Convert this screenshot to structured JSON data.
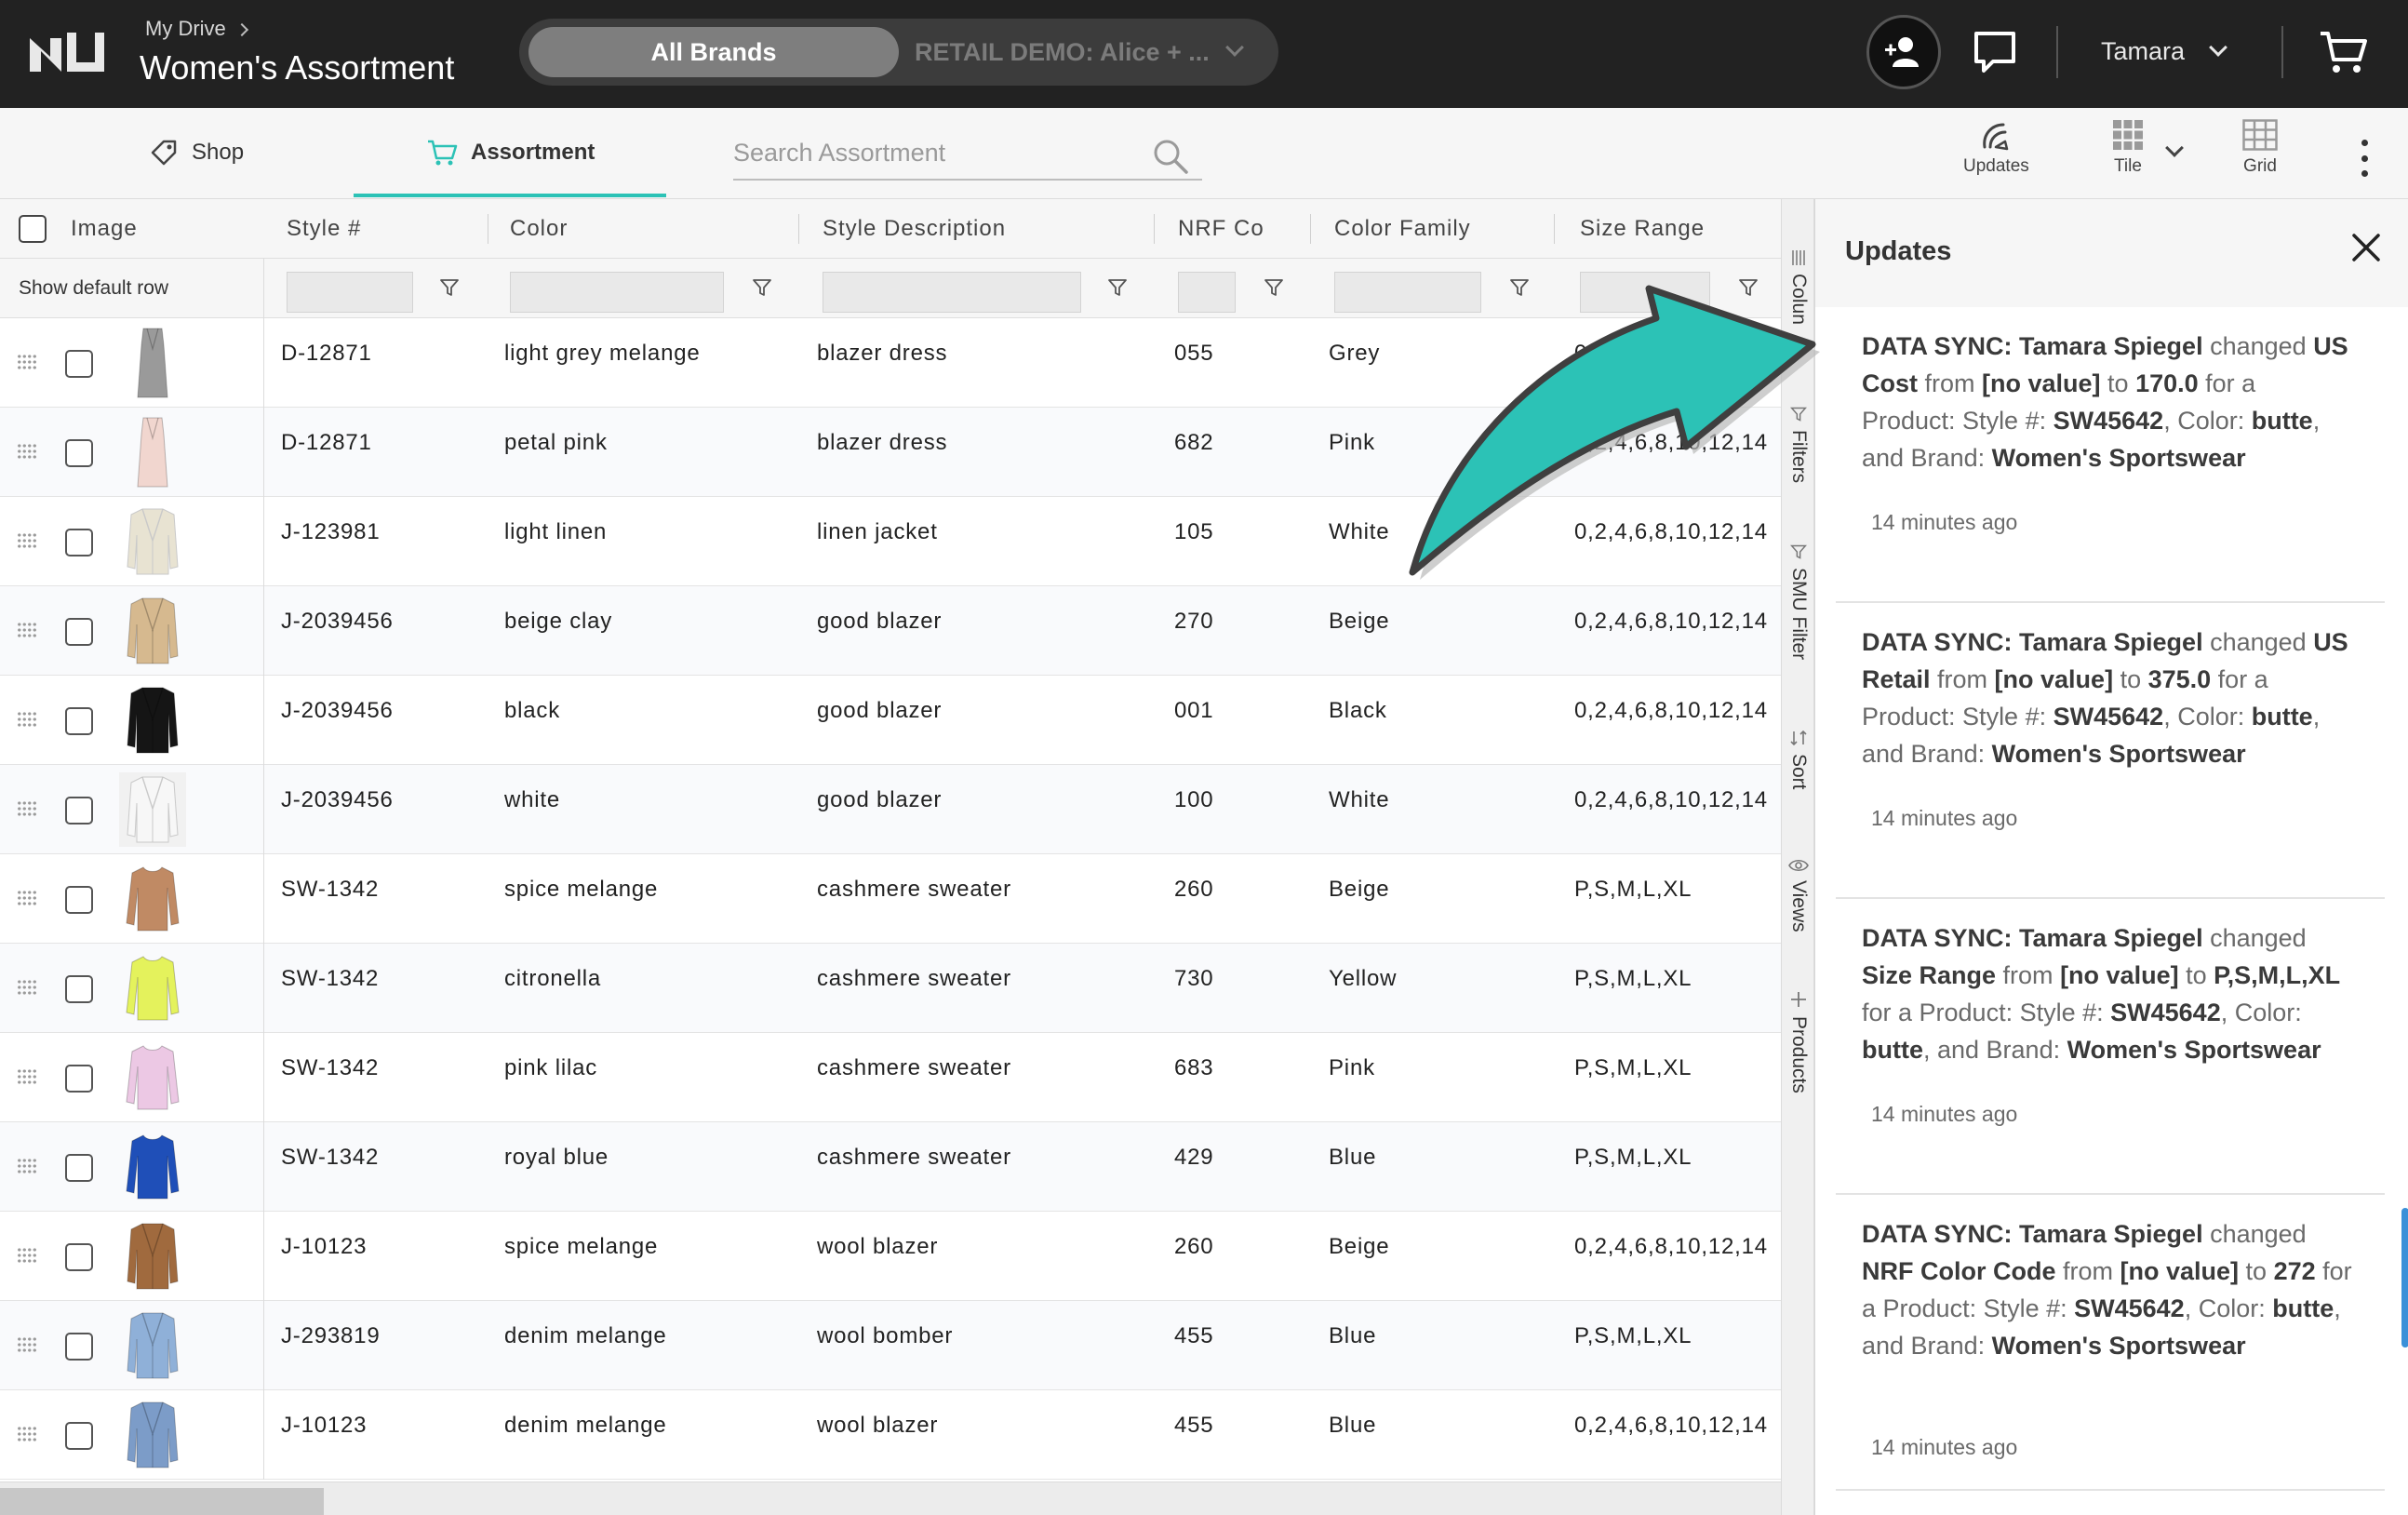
{
  "header": {
    "breadcrumb": "My Drive",
    "title": "Women's Assortment",
    "brand_selected": "All Brands",
    "brand_other": "RETAIL DEMO: Alice + ...",
    "user_name": "Tamara"
  },
  "toolbar": {
    "tabs": [
      {
        "label": "Shop",
        "icon": "tag-icon"
      },
      {
        "label": "Assortment",
        "icon": "cart-icon",
        "active": true
      }
    ],
    "search_placeholder": "Search Assortment",
    "buttons": [
      {
        "label": "Updates",
        "icon": "updates-icon"
      },
      {
        "label": "Tile",
        "icon": "tile-icon"
      },
      {
        "label": "Grid",
        "icon": "grid-icon"
      }
    ]
  },
  "grid": {
    "columns": [
      "Image",
      "Style #",
      "Color",
      "Style Description",
      "NRF Co",
      "Color Family",
      "Size Range"
    ],
    "show_default_row": "Show default row",
    "rows": [
      {
        "style": "D-12871",
        "color": "light grey melange",
        "desc": "blazer dress",
        "nrf": "055",
        "family": "Grey",
        "size": "0,2,4,6,8,10,12,14",
        "swatch": "#9a9a9a",
        "garment": "dress"
      },
      {
        "style": "D-12871",
        "color": "petal pink",
        "desc": "blazer dress",
        "nrf": "682",
        "family": "Pink",
        "size": "0,2,4,6,8,10,12,14",
        "swatch": "#f1d6cf",
        "garment": "dress"
      },
      {
        "style": "J-123981",
        "color": "light linen",
        "desc": "linen jacket",
        "nrf": "105",
        "family": "White",
        "size": "0,2,4,6,8,10,12,14",
        "swatch": "#e8e3d2",
        "garment": "jacket"
      },
      {
        "style": "J-2039456",
        "color": "beige clay",
        "desc": "good blazer",
        "nrf": "270",
        "family": "Beige",
        "size": "0,2,4,6,8,10,12,14",
        "swatch": "#d6b98f",
        "garment": "jacket"
      },
      {
        "style": "J-2039456",
        "color": "black",
        "desc": "good blazer",
        "nrf": "001",
        "family": "Black",
        "size": "0,2,4,6,8,10,12,14",
        "swatch": "#151515",
        "garment": "jacket"
      },
      {
        "style": "J-2039456",
        "color": "white",
        "desc": "good blazer",
        "nrf": "100",
        "family": "White",
        "size": "0,2,4,6,8,10,12,14",
        "swatch": "#f7f7f7",
        "garment": "jacket"
      },
      {
        "style": "SW-1342",
        "color": "spice melange",
        "desc": "cashmere sweater",
        "nrf": "260",
        "family": "Beige",
        "size": "P,S,M,L,XL",
        "swatch": "#c08a64",
        "garment": "sweater"
      },
      {
        "style": "SW-1342",
        "color": "citronella",
        "desc": "cashmere sweater",
        "nrf": "730",
        "family": "Yellow",
        "size": "P,S,M,L,XL",
        "swatch": "#e4f25c",
        "garment": "sweater"
      },
      {
        "style": "SW-1342",
        "color": "pink lilac",
        "desc": "cashmere sweater",
        "nrf": "683",
        "family": "Pink",
        "size": "P,S,M,L,XL",
        "swatch": "#ecc8e4",
        "garment": "sweater"
      },
      {
        "style": "SW-1342",
        "color": "royal blue",
        "desc": "cashmere sweater",
        "nrf": "429",
        "family": "Blue",
        "size": "P,S,M,L,XL",
        "swatch": "#1f4fb8",
        "garment": "sweater"
      },
      {
        "style": "J-10123",
        "color": "spice melange",
        "desc": "wool blazer",
        "nrf": "260",
        "family": "Beige",
        "size": "0,2,4,6,8,10,12,14",
        "swatch": "#a06a3e",
        "garment": "jacket"
      },
      {
        "style": "J-293819",
        "color": "denim melange",
        "desc": "wool bomber",
        "nrf": "455",
        "family": "Blue",
        "size": "P,S,M,L,XL",
        "swatch": "#8fb0d8",
        "garment": "jacket"
      },
      {
        "style": "J-10123",
        "color": "denim melange",
        "desc": "wool blazer",
        "nrf": "455",
        "family": "Blue",
        "size": "0,2,4,6,8,10,12,14",
        "swatch": "#7c9cc8",
        "garment": "jacket"
      }
    ]
  },
  "side_rail": [
    "Colun",
    "Filters",
    "SMU Filter",
    "Sort",
    "Views",
    "Products"
  ],
  "updates_panel": {
    "title": "Updates",
    "items": [
      {
        "parts": [
          [
            "b",
            "DATA SYNC: Tamara Spiegel"
          ],
          [
            "t",
            " changed "
          ],
          [
            "b",
            "US Cost"
          ],
          [
            "t",
            " from "
          ],
          [
            "b",
            "[no value]"
          ],
          [
            "t",
            " to "
          ],
          [
            "b",
            "170.0"
          ],
          [
            "t",
            " for a Product: Style #: "
          ],
          [
            "b",
            "SW45642"
          ],
          [
            "t",
            ", Color: "
          ],
          [
            "b",
            "butte"
          ],
          [
            "t",
            ", and Brand: "
          ],
          [
            "b",
            "Women's Sportswear"
          ]
        ],
        "time": "14 minutes ago"
      },
      {
        "parts": [
          [
            "b",
            "DATA SYNC: Tamara Spiegel"
          ],
          [
            "t",
            " changed "
          ],
          [
            "b",
            "US Retail"
          ],
          [
            "t",
            " from "
          ],
          [
            "b",
            "[no value]"
          ],
          [
            "t",
            " to "
          ],
          [
            "b",
            "375.0"
          ],
          [
            "t",
            " for a Product: Style #: "
          ],
          [
            "b",
            "SW45642"
          ],
          [
            "t",
            ", Color: "
          ],
          [
            "b",
            "butte"
          ],
          [
            "t",
            ", and Brand: "
          ],
          [
            "b",
            "Women's Sportswear"
          ]
        ],
        "time": "14 minutes ago"
      },
      {
        "parts": [
          [
            "b",
            "DATA SYNC: Tamara Spiegel"
          ],
          [
            "t",
            " changed "
          ],
          [
            "b",
            "Size Range"
          ],
          [
            "t",
            " from "
          ],
          [
            "b",
            "[no value]"
          ],
          [
            "t",
            " to "
          ],
          [
            "b",
            "P,S,M,L,XL"
          ],
          [
            "t",
            " for a Product: Style #: "
          ],
          [
            "b",
            "SW45642"
          ],
          [
            "t",
            ", Color: "
          ],
          [
            "b",
            "butte"
          ],
          [
            "t",
            ", and Brand: "
          ],
          [
            "b",
            "Women's Sportswear"
          ]
        ],
        "time": "14 minutes ago"
      },
      {
        "parts": [
          [
            "b",
            "DATA SYNC: Tamara Spiegel"
          ],
          [
            "t",
            " changed "
          ],
          [
            "b",
            "NRF Color Code"
          ],
          [
            "t",
            " from "
          ],
          [
            "b",
            "[no value]"
          ],
          [
            "t",
            " to "
          ],
          [
            "b",
            "272"
          ],
          [
            "t",
            " for a Product: Style #: "
          ],
          [
            "b",
            "SW45642"
          ],
          [
            "t",
            ", Color: "
          ],
          [
            "b",
            "butte"
          ],
          [
            "t",
            ", and Brand: "
          ],
          [
            "b",
            "Women's Sportswear"
          ]
        ],
        "time": "14 minutes ago"
      }
    ]
  },
  "colors": {
    "accent": "#2cc2b6",
    "topbar": "#222222"
  }
}
